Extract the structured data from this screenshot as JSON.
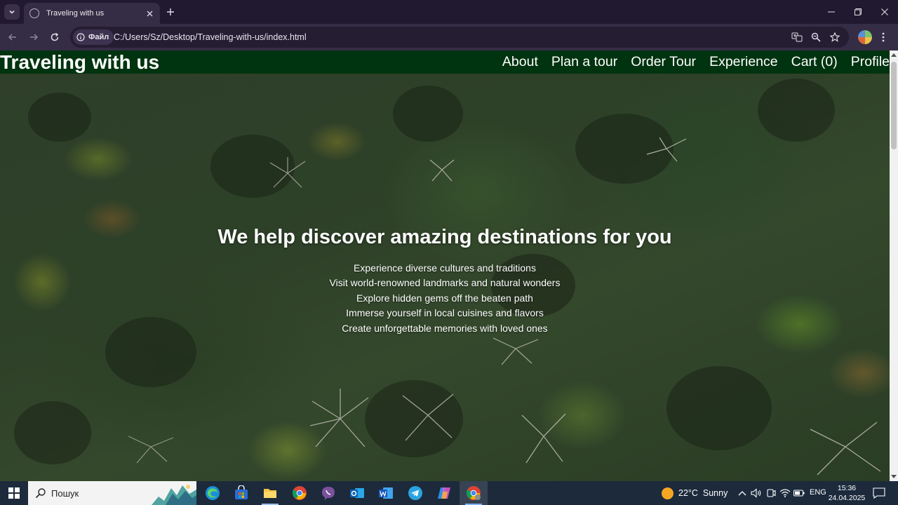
{
  "browser": {
    "tab_title": "Traveling with us",
    "scheme_chip": "Файл",
    "url": "C:/Users/Sz/Desktop/Traveling-with-us/index.html"
  },
  "site": {
    "logo": "Traveling with us",
    "nav": [
      "About",
      "Plan a tour",
      "Order Tour",
      "Experience",
      "Cart (0)",
      "Profile"
    ],
    "hero_title": "We help discover amazing destinations for you",
    "hero_points": [
      "Experience diverse cultures and traditions",
      "Visit world-renowned landmarks and natural wonders",
      "Explore hidden gems off the beaten path",
      "Immerse yourself in local cuisines and flavors",
      "Create unforgettable memories with loved ones"
    ]
  },
  "taskbar": {
    "search_label": "Пошук",
    "apps": [
      "edge-icon",
      "store-icon",
      "file-explorer-icon",
      "chrome-icon",
      "viber-icon",
      "outlook-icon",
      "word-icon",
      "telegram-icon",
      "copilot-icon",
      "chrome-active-icon"
    ],
    "weather_temp": "22°C",
    "weather_text": "Sunny",
    "language": "ENG",
    "time": "15:36",
    "date": "24.04.2025"
  },
  "colors": {
    "header_bg": "#00330f",
    "tab_strip": "#21192f",
    "toolbar": "#352c45",
    "taskbar": "#1c2a3c"
  }
}
